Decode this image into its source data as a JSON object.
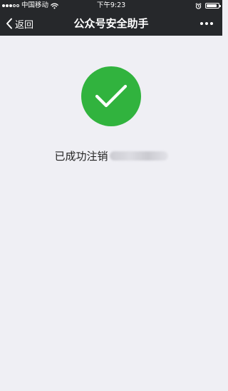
{
  "status_bar": {
    "carrier": "中国移动",
    "time": "下午9:23",
    "signal_strength": 3,
    "signal_max": 5,
    "battery_level": 0.9
  },
  "nav_bar": {
    "back_label": "返回",
    "title": "公众号安全助手"
  },
  "result": {
    "message": "已成功注销",
    "account_name_redacted": true
  },
  "colors": {
    "nav_background": "#26282b",
    "page_background": "#efeff4",
    "success_green": "#31b33e"
  },
  "icons": {
    "back": "chevron-left-icon",
    "more": "more-dots-icon",
    "success": "checkmark-circle-icon",
    "wifi": "wifi-icon",
    "alarm": "alarm-clock-icon",
    "battery": "battery-icon"
  }
}
